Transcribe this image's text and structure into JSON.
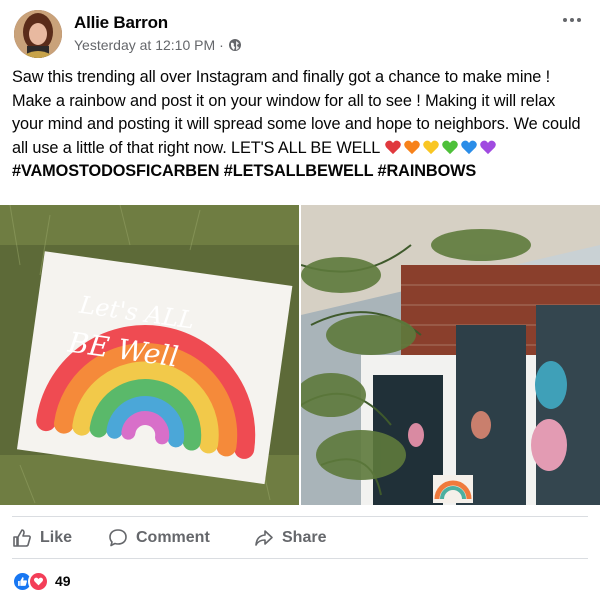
{
  "post": {
    "author": "Allie Barron",
    "timestamp": "Yesterday at 12:10 PM",
    "privacy_icon": "globe-icon",
    "text_main": "Saw this trending all over Instagram and finally got a chance to make mine ! Make a rainbow and post it on your window for all to see ! Making it will relax your mind and posting it will spread some love and hope to neighbors. We could all use a little of that right now. LET'S ALL BE WELL ",
    "heart_colors": [
      "#e0393e",
      "#f7821b",
      "#f9c623",
      "#4ec03a",
      "#2b8de8",
      "#a04be0"
    ],
    "hashtags": "#VAMOSTODOSFICARBEN #LETSALLBEWELL #RAINBOWS",
    "photo1": {
      "sign_line1": "Let's ALL",
      "sign_line2": "BE Well"
    }
  },
  "actions": {
    "like": "Like",
    "comment": "Comment",
    "share": "Share"
  },
  "reactions": {
    "count": "49",
    "like_color": "#1877f2",
    "love_color": "#f33e58"
  }
}
